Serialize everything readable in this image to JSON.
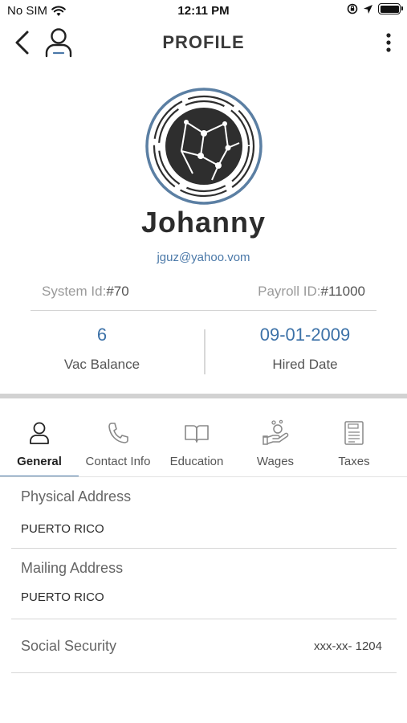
{
  "status_bar": {
    "carrier": "No SIM",
    "time": "12:11 PM"
  },
  "nav": {
    "title": "PROFILE"
  },
  "profile": {
    "name": "Johanny",
    "email": "jguz@yahoo.vom",
    "system_id_label": "System Id:",
    "system_id_value": "#70",
    "payroll_id_label": "Payroll ID:",
    "payroll_id_value": "#11000"
  },
  "stats": {
    "vac_balance_value": "6",
    "vac_balance_label": "Vac Balance",
    "hired_date_value": "09-01-2009",
    "hired_date_label": "Hired Date"
  },
  "tabs": [
    {
      "label": "General",
      "icon": "person-icon",
      "active": true
    },
    {
      "label": "Contact Info",
      "icon": "phone-icon",
      "active": false
    },
    {
      "label": "Education",
      "icon": "book-icon",
      "active": false
    },
    {
      "label": "Wages",
      "icon": "hand-coins-icon",
      "active": false
    },
    {
      "label": "Taxes",
      "icon": "tax-form-icon",
      "active": false
    }
  ],
  "details": {
    "physical_address_label": "Physical Address",
    "physical_address_value": "PUERTO RICO",
    "mailing_address_label": "Mailing Address",
    "mailing_address_value": "PUERTO RICO",
    "social_security_label": "Social Security",
    "social_security_value": "xxx-xx- 1204"
  },
  "colors": {
    "accent": "#4a78a8",
    "avatar_ring": "#5b7fa3",
    "separator": "#d2d2d2"
  }
}
